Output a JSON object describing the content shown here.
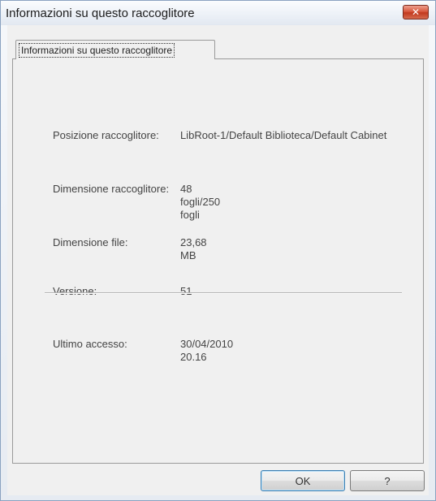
{
  "window": {
    "title": "Informazioni su questo raccoglitore",
    "close_label": "✕"
  },
  "tabs": [
    {
      "label": "Informazioni su questo raccoglitore",
      "selected": true
    }
  ],
  "info": {
    "position_label": "Posizione raccoglitore:",
    "position_value": "LibRoot-1/Default Biblioteca/Default Cabinet",
    "size_label": "Dimensione raccoglitore:",
    "size_value": "48 fogli/250 fogli",
    "file_size_label": "Dimensione file:",
    "file_size_value": "23,68 MB",
    "version_label": "Versione:",
    "version_value": "51",
    "last_access_label": "Ultimo accesso:",
    "last_access_value": "30/04/2010 20.16"
  },
  "buttons": {
    "ok_label": "OK",
    "help_label": "?"
  }
}
